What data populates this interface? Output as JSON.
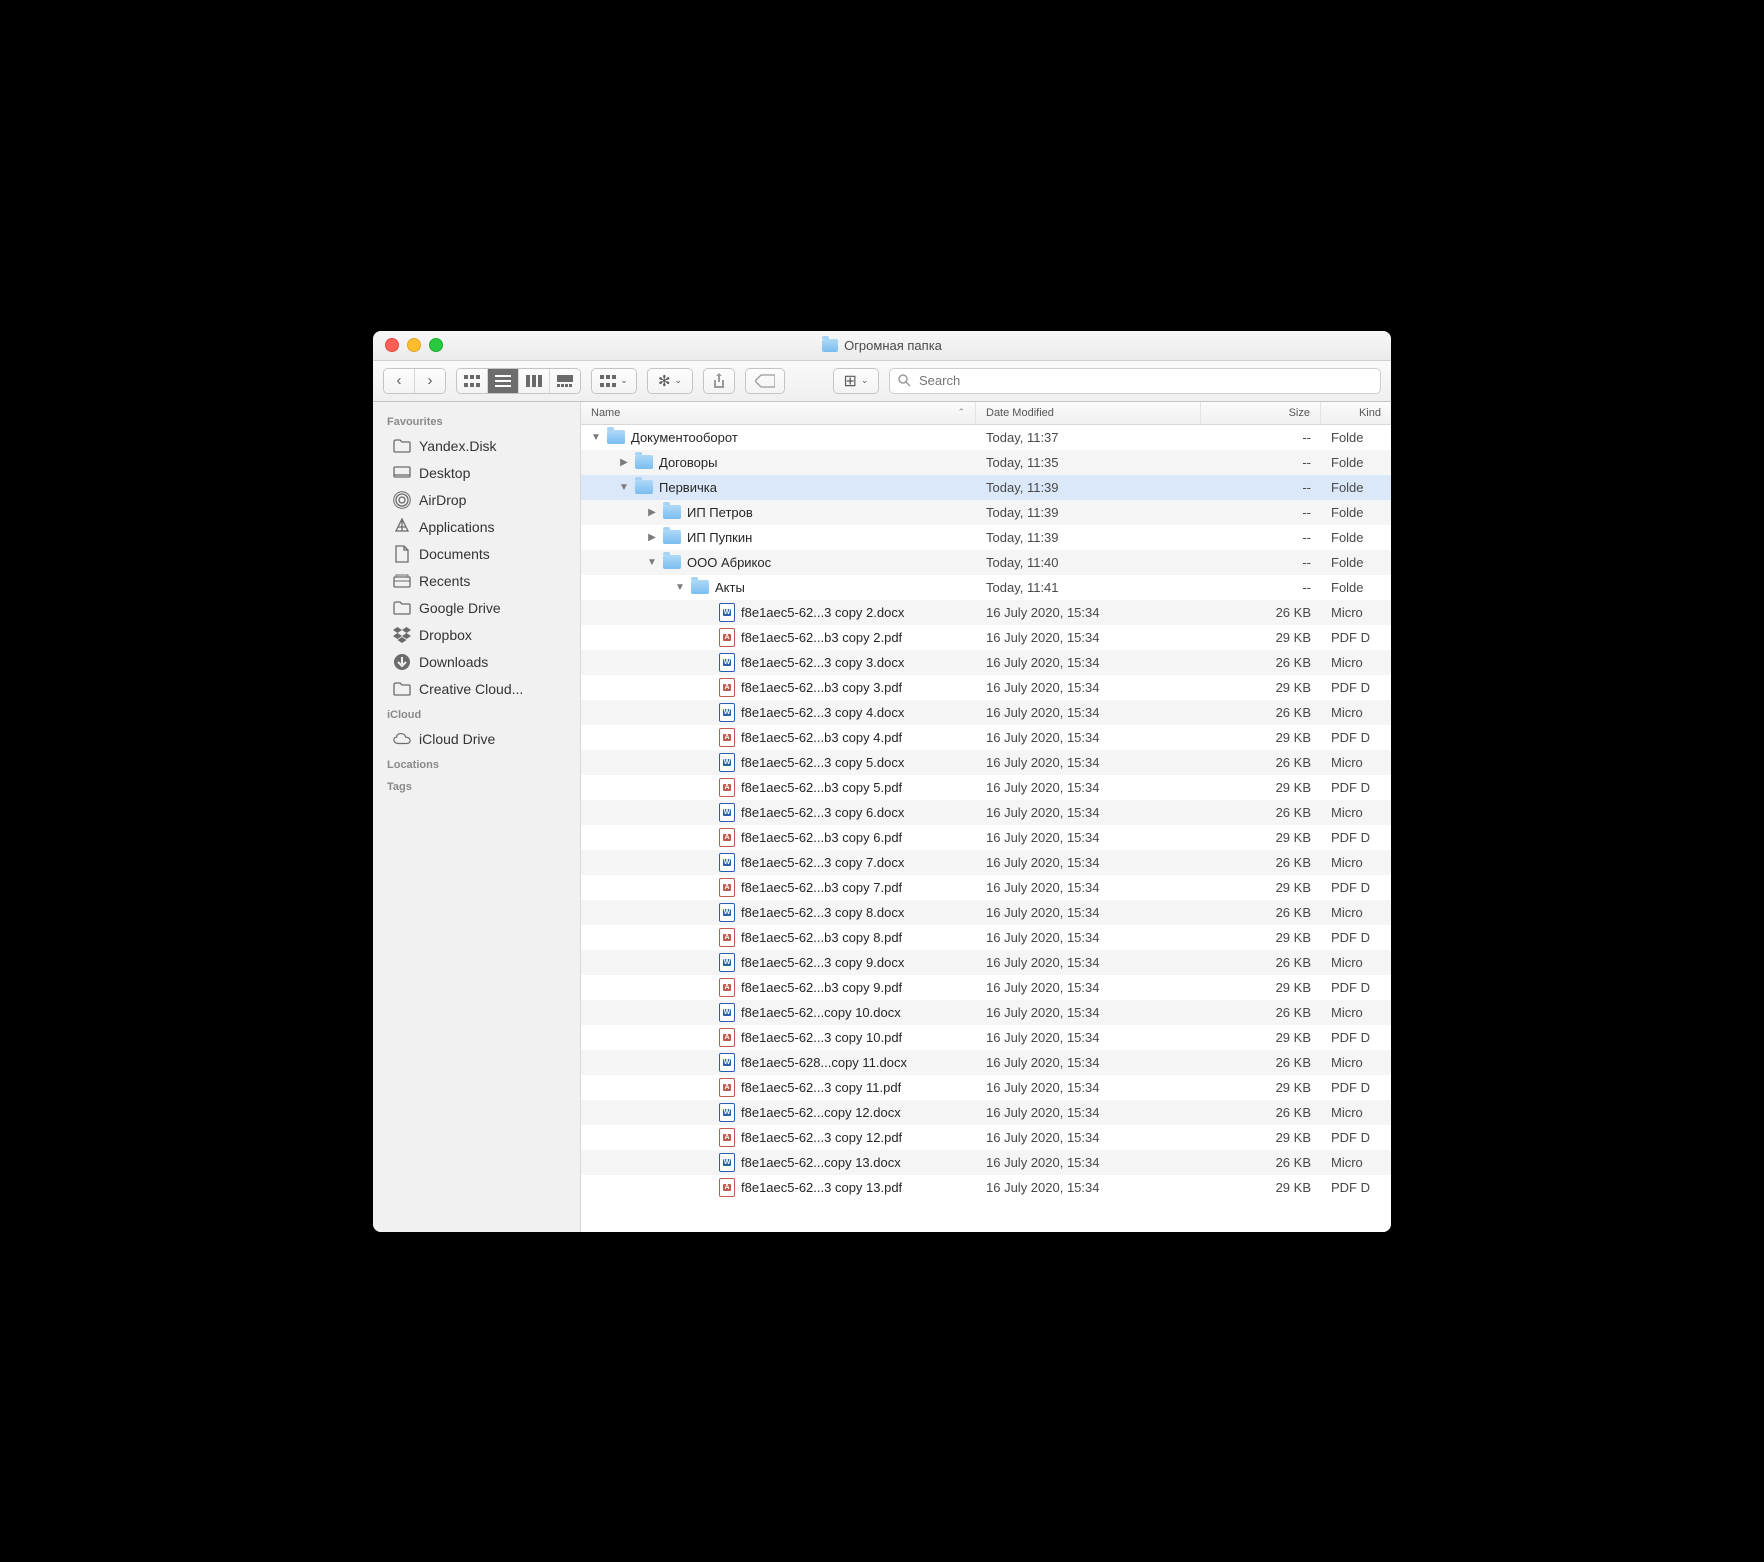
{
  "window_title": "Огромная папка",
  "search_placeholder": "Search",
  "columns": {
    "name": "Name",
    "date": "Date Modified",
    "size": "Size",
    "kind": "Kind"
  },
  "sidebar": {
    "sections": [
      {
        "header": "Favourites",
        "items": [
          {
            "icon": "folder",
            "label": "Yandex.Disk"
          },
          {
            "icon": "desktop",
            "label": "Desktop"
          },
          {
            "icon": "airdrop",
            "label": "AirDrop"
          },
          {
            "icon": "apps",
            "label": "Applications"
          },
          {
            "icon": "documents",
            "label": "Documents"
          },
          {
            "icon": "recents",
            "label": "Recents"
          },
          {
            "icon": "folder",
            "label": "Google Drive"
          },
          {
            "icon": "dropbox",
            "label": "Dropbox"
          },
          {
            "icon": "downloads",
            "label": "Downloads"
          },
          {
            "icon": "folder",
            "label": "Creative Cloud..."
          }
        ]
      },
      {
        "header": "iCloud",
        "items": [
          {
            "icon": "cloud",
            "label": "iCloud Drive"
          }
        ]
      },
      {
        "header": "Locations",
        "items": []
      },
      {
        "header": "Tags",
        "items": []
      }
    ]
  },
  "rows": [
    {
      "indent": 0,
      "disc": "down",
      "icon": "folder",
      "name": "Документооборот",
      "date": "Today, 11:37",
      "size": "--",
      "kind": "Folde"
    },
    {
      "indent": 1,
      "disc": "right",
      "icon": "folder",
      "name": "Договоры",
      "date": "Today, 11:35",
      "size": "--",
      "kind": "Folde"
    },
    {
      "indent": 1,
      "disc": "down",
      "icon": "folder",
      "name": "Первичка",
      "date": "Today, 11:39",
      "size": "--",
      "kind": "Folde",
      "sel": true
    },
    {
      "indent": 2,
      "disc": "right",
      "icon": "folder",
      "name": "ИП Петров",
      "date": "Today, 11:39",
      "size": "--",
      "kind": "Folde"
    },
    {
      "indent": 2,
      "disc": "right",
      "icon": "folder",
      "name": "ИП Пупкин",
      "date": "Today, 11:39",
      "size": "--",
      "kind": "Folde"
    },
    {
      "indent": 2,
      "disc": "down",
      "icon": "folder",
      "name": "ООО Абрикос",
      "date": "Today, 11:40",
      "size": "--",
      "kind": "Folde"
    },
    {
      "indent": 3,
      "disc": "down",
      "icon": "folder",
      "name": "Акты",
      "date": "Today, 11:41",
      "size": "--",
      "kind": "Folde"
    },
    {
      "indent": 4,
      "disc": "",
      "icon": "docx",
      "name": "f8e1aec5-62...3 copy 2.docx",
      "date": "16 July 2020, 15:34",
      "size": "26 KB",
      "kind": "Micro"
    },
    {
      "indent": 4,
      "disc": "",
      "icon": "pdf",
      "name": "f8e1aec5-62...b3 copy 2.pdf",
      "date": "16 July 2020, 15:34",
      "size": "29 KB",
      "kind": "PDF D"
    },
    {
      "indent": 4,
      "disc": "",
      "icon": "docx",
      "name": "f8e1aec5-62...3 copy 3.docx",
      "date": "16 July 2020, 15:34",
      "size": "26 KB",
      "kind": "Micro"
    },
    {
      "indent": 4,
      "disc": "",
      "icon": "pdf",
      "name": "f8e1aec5-62...b3 copy 3.pdf",
      "date": "16 July 2020, 15:34",
      "size": "29 KB",
      "kind": "PDF D"
    },
    {
      "indent": 4,
      "disc": "",
      "icon": "docx",
      "name": "f8e1aec5-62...3 copy 4.docx",
      "date": "16 July 2020, 15:34",
      "size": "26 KB",
      "kind": "Micro"
    },
    {
      "indent": 4,
      "disc": "",
      "icon": "pdf",
      "name": "f8e1aec5-62...b3 copy 4.pdf",
      "date": "16 July 2020, 15:34",
      "size": "29 KB",
      "kind": "PDF D"
    },
    {
      "indent": 4,
      "disc": "",
      "icon": "docx",
      "name": "f8e1aec5-62...3 copy 5.docx",
      "date": "16 July 2020, 15:34",
      "size": "26 KB",
      "kind": "Micro"
    },
    {
      "indent": 4,
      "disc": "",
      "icon": "pdf",
      "name": "f8e1aec5-62...b3 copy 5.pdf",
      "date": "16 July 2020, 15:34",
      "size": "29 KB",
      "kind": "PDF D"
    },
    {
      "indent": 4,
      "disc": "",
      "icon": "docx",
      "name": "f8e1aec5-62...3 copy 6.docx",
      "date": "16 July 2020, 15:34",
      "size": "26 KB",
      "kind": "Micro"
    },
    {
      "indent": 4,
      "disc": "",
      "icon": "pdf",
      "name": "f8e1aec5-62...b3 copy 6.pdf",
      "date": "16 July 2020, 15:34",
      "size": "29 KB",
      "kind": "PDF D"
    },
    {
      "indent": 4,
      "disc": "",
      "icon": "docx",
      "name": "f8e1aec5-62...3 copy 7.docx",
      "date": "16 July 2020, 15:34",
      "size": "26 KB",
      "kind": "Micro"
    },
    {
      "indent": 4,
      "disc": "",
      "icon": "pdf",
      "name": "f8e1aec5-62...b3 copy 7.pdf",
      "date": "16 July 2020, 15:34",
      "size": "29 KB",
      "kind": "PDF D"
    },
    {
      "indent": 4,
      "disc": "",
      "icon": "docx",
      "name": "f8e1aec5-62...3 copy 8.docx",
      "date": "16 July 2020, 15:34",
      "size": "26 KB",
      "kind": "Micro"
    },
    {
      "indent": 4,
      "disc": "",
      "icon": "pdf",
      "name": "f8e1aec5-62...b3 copy 8.pdf",
      "date": "16 July 2020, 15:34",
      "size": "29 KB",
      "kind": "PDF D"
    },
    {
      "indent": 4,
      "disc": "",
      "icon": "docx",
      "name": "f8e1aec5-62...3 copy 9.docx",
      "date": "16 July 2020, 15:34",
      "size": "26 KB",
      "kind": "Micro"
    },
    {
      "indent": 4,
      "disc": "",
      "icon": "pdf",
      "name": "f8e1aec5-62...b3 copy 9.pdf",
      "date": "16 July 2020, 15:34",
      "size": "29 KB",
      "kind": "PDF D"
    },
    {
      "indent": 4,
      "disc": "",
      "icon": "docx",
      "name": "f8e1aec5-62...copy 10.docx",
      "date": "16 July 2020, 15:34",
      "size": "26 KB",
      "kind": "Micro"
    },
    {
      "indent": 4,
      "disc": "",
      "icon": "pdf",
      "name": "f8e1aec5-62...3 copy 10.pdf",
      "date": "16 July 2020, 15:34",
      "size": "29 KB",
      "kind": "PDF D"
    },
    {
      "indent": 4,
      "disc": "",
      "icon": "docx",
      "name": "f8e1aec5-628...copy 11.docx",
      "date": "16 July 2020, 15:34",
      "size": "26 KB",
      "kind": "Micro"
    },
    {
      "indent": 4,
      "disc": "",
      "icon": "pdf",
      "name": "f8e1aec5-62...3 copy 11.pdf",
      "date": "16 July 2020, 15:34",
      "size": "29 KB",
      "kind": "PDF D"
    },
    {
      "indent": 4,
      "disc": "",
      "icon": "docx",
      "name": "f8e1aec5-62...copy 12.docx",
      "date": "16 July 2020, 15:34",
      "size": "26 KB",
      "kind": "Micro"
    },
    {
      "indent": 4,
      "disc": "",
      "icon": "pdf",
      "name": "f8e1aec5-62...3 copy 12.pdf",
      "date": "16 July 2020, 15:34",
      "size": "29 KB",
      "kind": "PDF D"
    },
    {
      "indent": 4,
      "disc": "",
      "icon": "docx",
      "name": "f8e1aec5-62...copy 13.docx",
      "date": "16 July 2020, 15:34",
      "size": "26 KB",
      "kind": "Micro"
    },
    {
      "indent": 4,
      "disc": "",
      "icon": "pdf",
      "name": "f8e1aec5-62...3 copy 13.pdf",
      "date": "16 July 2020, 15:34",
      "size": "29 KB",
      "kind": "PDF D"
    }
  ]
}
